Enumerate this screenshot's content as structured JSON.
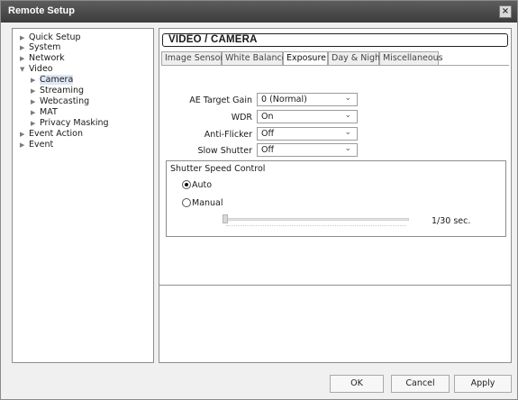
{
  "window": {
    "title": "Remote Setup",
    "close_label": "×"
  },
  "sidebar": {
    "items": [
      {
        "label": "Quick Setup",
        "expanded": false
      },
      {
        "label": "System",
        "expanded": false
      },
      {
        "label": "Network",
        "expanded": false
      },
      {
        "label": "Video",
        "expanded": true
      },
      {
        "label": "Camera",
        "selected": true
      },
      {
        "label": "Streaming"
      },
      {
        "label": "Webcasting"
      },
      {
        "label": "MAT"
      },
      {
        "label": "Privacy Masking"
      },
      {
        "label": "Event Action",
        "expanded": false
      },
      {
        "label": "Event",
        "expanded": false
      }
    ]
  },
  "panel": {
    "title": "VIDEO / CAMERA",
    "tabs": [
      {
        "label": "Image Sensor"
      },
      {
        "label": "White Balance"
      },
      {
        "label": "Exposure",
        "active": true
      },
      {
        "label": "Day & Night"
      },
      {
        "label": "Miscellaneous"
      }
    ],
    "fields": {
      "ae_target_gain": {
        "label": "AE Target Gain",
        "value": "0 (Normal)"
      },
      "wdr": {
        "label": "WDR",
        "value": "On"
      },
      "anti_flicker": {
        "label": "Anti-Flicker",
        "value": "Off"
      },
      "slow_shutter": {
        "label": "Slow Shutter",
        "value": "Off"
      }
    },
    "shutter": {
      "group_title": "Shutter Speed Control",
      "auto_label": "Auto",
      "manual_label": "Manual",
      "selected": "Auto",
      "speed_value": "1/30 sec.",
      "slider_fraction": 0.0
    }
  },
  "buttons": {
    "ok": "OK",
    "cancel": "Cancel",
    "apply": "Apply"
  },
  "icons": {
    "collapsed": "triangle-right-icon",
    "expanded": "triangle-down-icon",
    "dropdown": "chevron-down-icon"
  }
}
